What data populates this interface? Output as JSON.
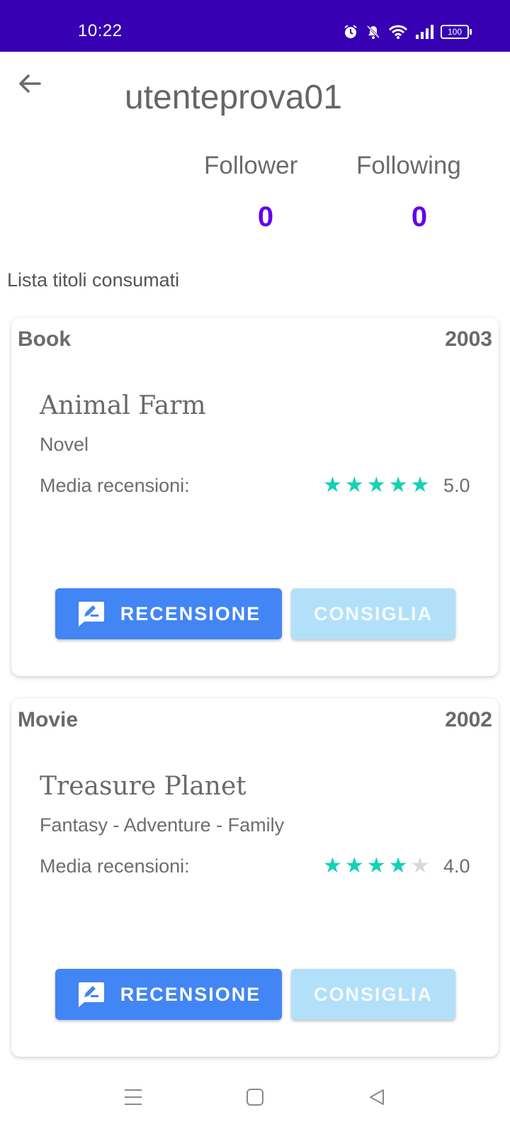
{
  "status_bar": {
    "time": "10:22",
    "battery": "100",
    "icons": [
      "alarm-icon",
      "mute-notifications-icon",
      "wifi-icon",
      "signal-icon",
      "battery-icon"
    ]
  },
  "header": {
    "username": "utenteprova01",
    "back_icon": "arrow-left-icon"
  },
  "stats": {
    "follower_label": "Follower",
    "follower_value": "0",
    "following_label": "Following",
    "following_value": "0"
  },
  "section_title": "Lista titoli consumati",
  "cards": [
    {
      "type": "Book",
      "year": "2003",
      "title": "Animal Farm",
      "genre": "Novel",
      "rating_label": "Media recensioni:",
      "rating": 5,
      "rating_value": "5.0",
      "review_button": "RECENSIONE",
      "suggest_button": "CONSIGLIA"
    },
    {
      "type": "Movie",
      "year": "2002",
      "title": "Treasure Planet",
      "genre": "Fantasy - Adventure - Family",
      "rating_label": "Media recensioni:",
      "rating": 4,
      "rating_value": "4.0",
      "review_button": "RECENSIONE",
      "suggest_button": "CONSIGLIA"
    }
  ],
  "colors": {
    "status_bar": "#3700b3",
    "stat_value": "#6200ee",
    "star_on": "#14d1b5",
    "star_off": "#d9d9d9",
    "review_button": "#4285f4",
    "suggest_button": "#b3e0f9"
  },
  "nav_bar": {
    "icons": [
      "menu-icon",
      "home-icon",
      "back-icon"
    ]
  }
}
